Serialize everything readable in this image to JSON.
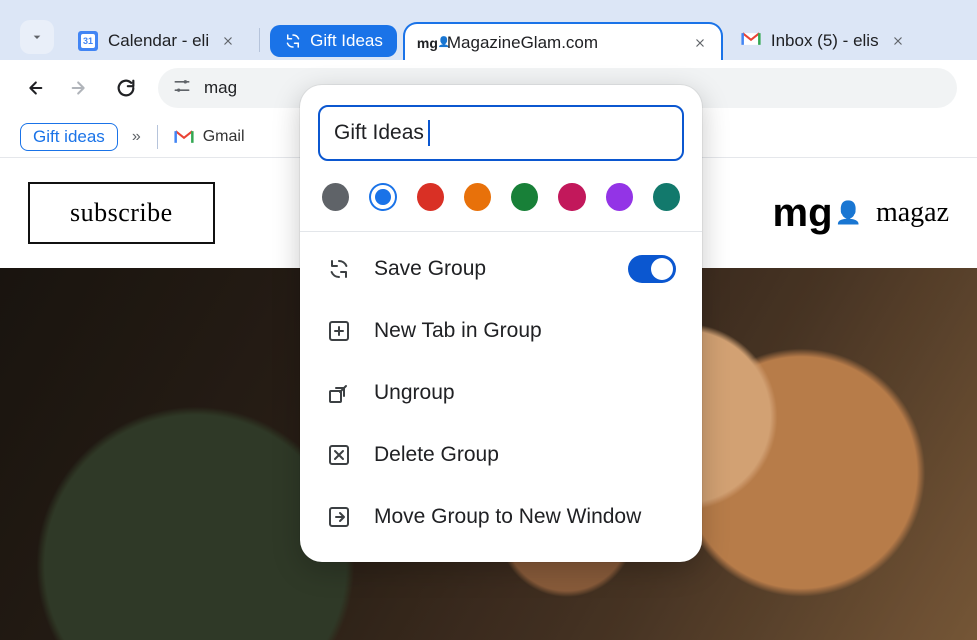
{
  "tabs": {
    "calendar": {
      "title": "Calendar - eli"
    },
    "group_chip": {
      "label": "Gift Ideas"
    },
    "magazine": {
      "title": "MagazineGlam.com"
    },
    "inbox": {
      "title": "Inbox (5) - elis"
    }
  },
  "toolbar": {
    "omnibox_text": "mag"
  },
  "bookmarks": {
    "group": "Gift ideas",
    "gmail": "Gmail"
  },
  "page": {
    "subscribe": "subscribe",
    "brand_word": "magaz"
  },
  "popover": {
    "groupname": "Gift Ideas",
    "colors": {
      "grey": "#5f6368",
      "blue": "#1a73e8",
      "red": "#d93025",
      "orange": "#e8710a",
      "green": "#188038",
      "pink": "#c5221f",
      "purple": "#9334e6",
      "teal": "#12796c"
    },
    "selected_color": "blue",
    "items": {
      "save": "Save Group",
      "newtab": "New Tab in Group",
      "ungroup": "Ungroup",
      "delete": "Delete Group",
      "move": "Move Group to New Window"
    },
    "save_toggle_on": true
  }
}
